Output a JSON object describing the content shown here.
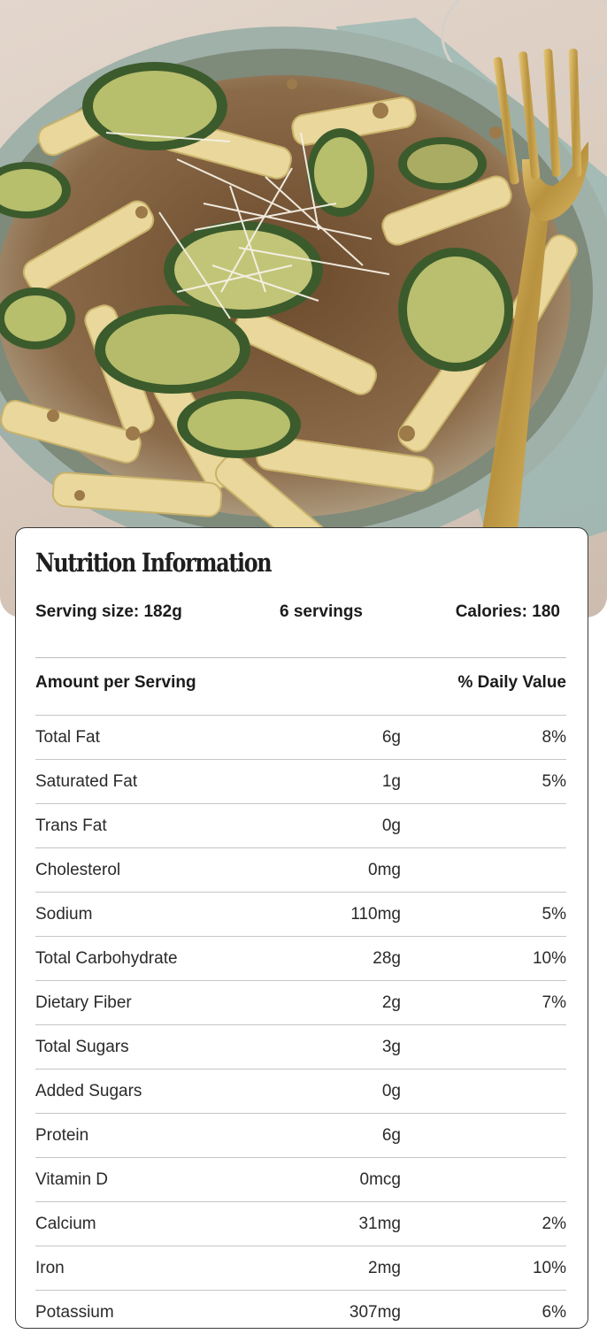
{
  "photo": {
    "alt_icon": "pasta-dish-photo"
  },
  "card": {
    "title": "Nutrition Information",
    "serving_size": "Serving size:  182g",
    "servings": "6  servings",
    "calories": "Calories: 180",
    "amount_header": "Amount per Serving",
    "dv_header": "% Daily Value",
    "rows": [
      {
        "name": "Total Fat",
        "amount": "6g",
        "dv": "8%"
      },
      {
        "name": "Saturated Fat",
        "amount": "1g",
        "dv": "5%"
      },
      {
        "name": "Trans Fat",
        "amount": "0g",
        "dv": ""
      },
      {
        "name": "Cholesterol",
        "amount": "0mg",
        "dv": ""
      },
      {
        "name": "Sodium",
        "amount": "110mg",
        "dv": "5%"
      },
      {
        "name": "Total Carbohydrate",
        "amount": "28g",
        "dv": "10%"
      },
      {
        "name": "Dietary Fiber",
        "amount": "2g",
        "dv": "7%"
      },
      {
        "name": "Total Sugars",
        "amount": "3g",
        "dv": ""
      },
      {
        "name": "Added Sugars",
        "amount": "0g",
        "dv": ""
      },
      {
        "name": "Protein",
        "amount": "6g",
        "dv": ""
      },
      {
        "name": "Vitamin D",
        "amount": "0mcg",
        "dv": ""
      },
      {
        "name": "Calcium",
        "amount": "31mg",
        "dv": "2%"
      },
      {
        "name": "Iron",
        "amount": "2mg",
        "dv": "10%"
      },
      {
        "name": "Potassium",
        "amount": "307mg",
        "dv": "6%"
      }
    ]
  }
}
